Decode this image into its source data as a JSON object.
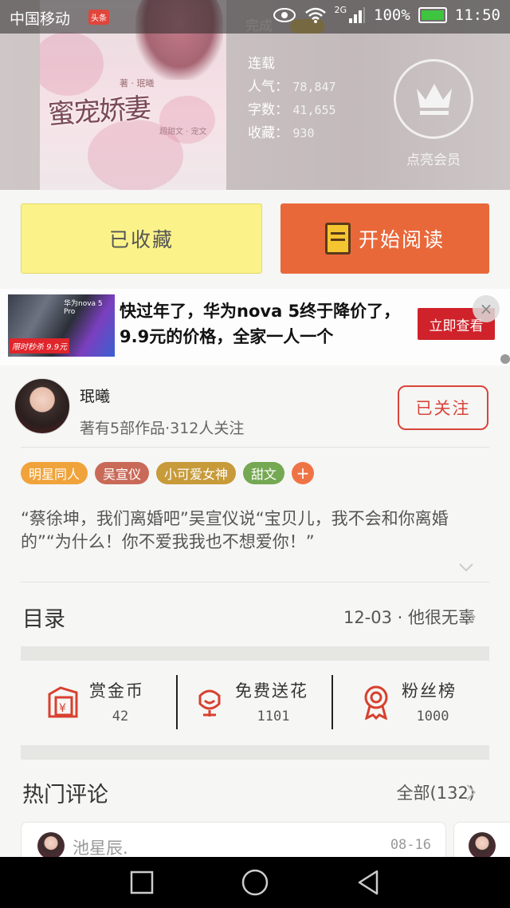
{
  "status_bar": {
    "carrier": "中国移动",
    "news_badge": "头条",
    "network": "2G",
    "battery_pct": "100%",
    "time": "11:50"
  },
  "book": {
    "status_top": "完成",
    "cover_title": "蜜宠娇妻",
    "cover_sub": "著 · 珉曦",
    "cover_sub2": "超甜文 · 宠文",
    "serial": "连载",
    "popularity_label": "人气：",
    "popularity_value": "78,847",
    "words_label": "字数：",
    "words_value": "41,655",
    "favorites_label": "收藏：",
    "favorites_value": "930",
    "vip_label": "点亮会员"
  },
  "actions": {
    "collected_label": "已收藏",
    "read_label": "开始阅读"
  },
  "ad": {
    "brand": "华为nova 5 Pro",
    "promo": "限时秒杀 9.9元",
    "text": "快过年了，华为nova 5终于降价了，9.9元的价格，全家一人一个",
    "cta": "立即查看",
    "close": "×"
  },
  "author": {
    "name": "珉曦",
    "meta": "著有5部作品·312人关注",
    "follow_label": "已关注"
  },
  "tags": [
    {
      "label": "明星同人",
      "color": "#f0a33a"
    },
    {
      "label": "吴宣仪",
      "color": "#c96a59"
    },
    {
      "label": "小可爱女神",
      "color": "#c79a3a"
    },
    {
      "label": "甜文",
      "color": "#75a852"
    },
    {
      "label": "+",
      "color": "#ef7445"
    }
  ],
  "synopsis": "“蔡徐坤，我们离婚吧”吴宣仪说“宝贝儿，我不会和你离婚的”“为什么！你不爱我我也不想爱你！”",
  "toc": {
    "title": "目录",
    "latest": "12-03 · 他很无辜"
  },
  "stats": [
    {
      "label": "赏金币",
      "value": "42",
      "icon": "red-envelope-icon"
    },
    {
      "label": "免费送花",
      "value": "1101",
      "icon": "flower-icon"
    },
    {
      "label": "粉丝榜",
      "value": "1000",
      "icon": "ribbon-badge-icon"
    }
  ],
  "comments": {
    "title": "热门评论",
    "all_label": "全部(132)",
    "items": [
      {
        "name": "池星辰.",
        "date": "08-16"
      }
    ]
  },
  "colors": {
    "accent_orange": "#e9683a",
    "collected_yellow": "#fbf38a",
    "follow_red": "#d9443b",
    "icon_red": "#d8402f"
  }
}
